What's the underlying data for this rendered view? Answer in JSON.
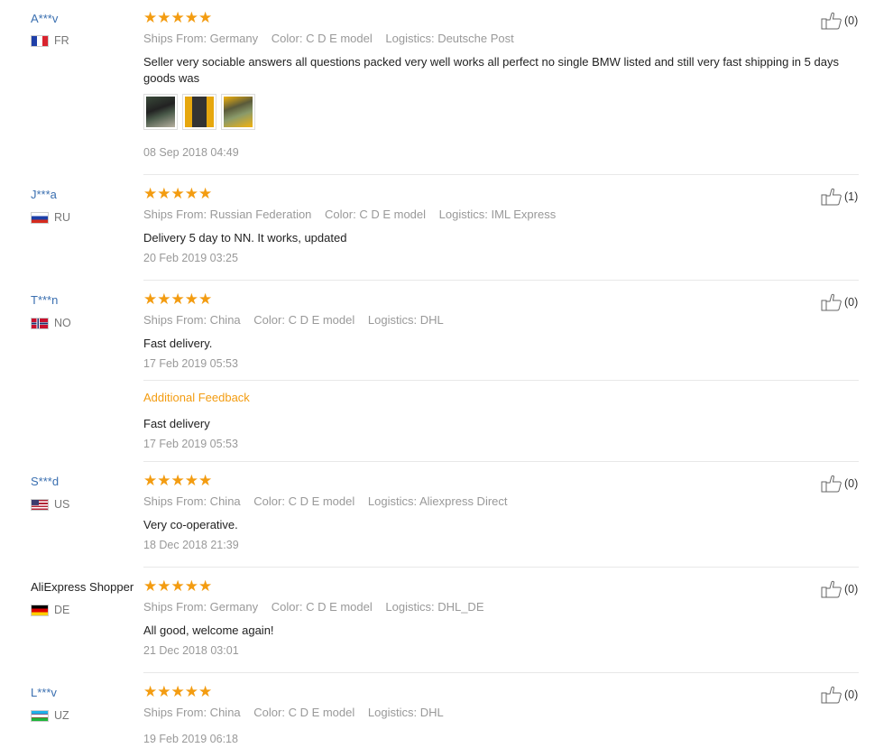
{
  "reviews": [
    {
      "user": "A***v",
      "country": "FR",
      "flag": "fr",
      "stars": "★★★★★",
      "ships_from": "Ships From: Germany",
      "color": "Color: C D E model",
      "logistics": "Logistics: Deutsche Post",
      "text": "Seller very sociable answers all questions packed very well works all perfect no single BMW listed and still very fast shipping in 5 days goods was",
      "date": "08 Sep 2018 04:49",
      "helpful": "(0)"
    },
    {
      "user": "J***a",
      "country": "RU",
      "flag": "ru",
      "stars": "★★★★★",
      "ships_from": "Ships From: Russian Federation",
      "color": "Color: C D E model",
      "logistics": "Logistics: IML Express",
      "text": "Delivery 5 day to NN. It works, updated",
      "date": "20 Feb 2019 03:25",
      "helpful": "(1)"
    },
    {
      "user": "T***n",
      "country": "NO",
      "flag": "no",
      "stars": "★★★★★",
      "ships_from": "Ships From: China",
      "color": "Color: C D E model",
      "logistics": "Logistics: DHL",
      "text": "Fast delivery.",
      "date": "17 Feb 2019 05:53",
      "additional_label": "Additional Feedback",
      "additional_text": "Fast delivery",
      "additional_date": "17 Feb 2019 05:53",
      "helpful": "(0)"
    },
    {
      "user": "S***d",
      "country": "US",
      "flag": "us",
      "stars": "★★★★★",
      "ships_from": "Ships From: China",
      "color": "Color: C D E model",
      "logistics": "Logistics: Aliexpress Direct",
      "text": "Very co-operative.",
      "date": "18 Dec 2018 21:39",
      "helpful": "(0)"
    },
    {
      "user": "AliExpress Shopper",
      "country": "DE",
      "flag": "de",
      "stars": "★★★★★",
      "ships_from": "Ships From: Germany",
      "color": "Color: C D E model",
      "logistics": "Logistics: DHL_DE",
      "text": "All good, welcome again!",
      "date": "21 Dec 2018 03:01",
      "helpful": "(0)"
    },
    {
      "user": "L***v",
      "country": "UZ",
      "flag": "uz",
      "stars": "★★★★★",
      "ships_from": "Ships From: China",
      "color": "Color: C D E model",
      "logistics": "Logistics: DHL",
      "date": "19 Feb 2019 06:18",
      "helpful": "(0)"
    }
  ],
  "colors": {
    "star": "#f39c11",
    "username_link": "#3a6fb0",
    "meta": "#999999",
    "additional_feedback": "#f39c11"
  }
}
